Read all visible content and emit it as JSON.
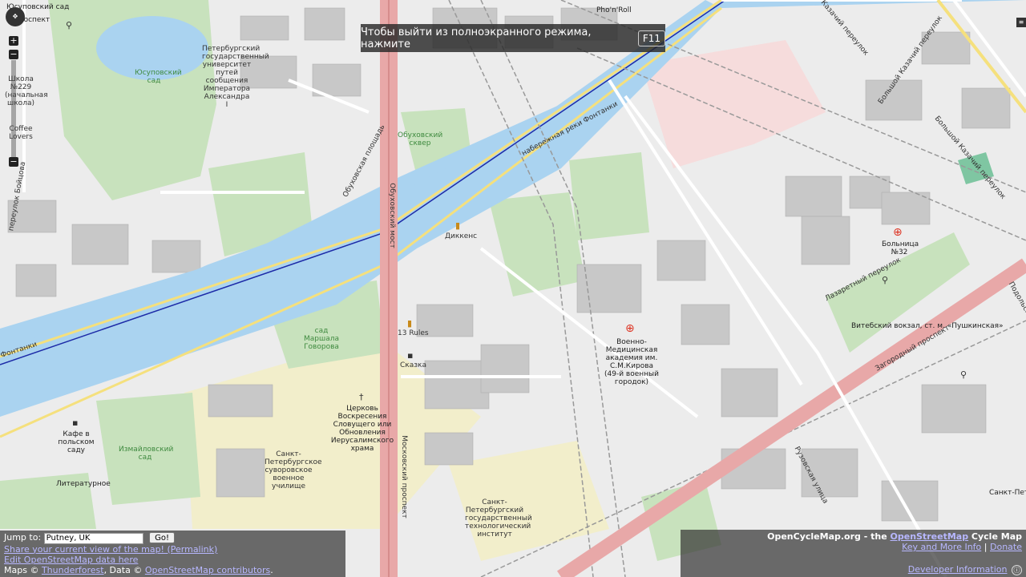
{
  "fullscreen_notice": {
    "text": "Чтобы выйти из полноэкранного режима, нажмите",
    "key": "F11"
  },
  "zoom": {
    "in": "+",
    "out": "−",
    "minus_mid": "−"
  },
  "labels": {
    "yusupov_garden_top": "Юсуповский сад",
    "prospekt_top": "проспект",
    "pho_n_roll": "Pho'n'Roll",
    "yusupov_garden": "Юсуповский сад",
    "university": "Петербургский государственный университет путей сообщения Императора Александра I",
    "school": "Школа №229 (начальная школа)",
    "coffee_lovers": "Coffee Lovers",
    "obukhovsky_sq": "Обуховский сквер",
    "obukhovskaya_ploshchad": "Обуховская площадь",
    "obukhovsky_most": "Обуховский мост",
    "naberezhnaya": "набережная реки Фонтанки",
    "fontanki_left": "Фонтанки",
    "dickens": "Диккенс",
    "thirteen_rules": "13 Rules",
    "skazka": "Сказка",
    "marshal_garden": "сад Маршала Говорова",
    "church": "Церковь Воскресения Словущего или Обновления Иерусалимского храма",
    "cafe": "Кафе в польском саду",
    "izmailovsky": "Измайловский сад",
    "literaturnoe": "Литературное",
    "suvorov": "Санкт-Петербургское суворовское военное училище",
    "moskovsky": "Московский проспект",
    "tech_inst": "Санкт-Петербургский государственный технологический институт",
    "military_med": "Военно-Медицинская академия им. С.М.Кирова (49-й военный городок)",
    "hospital": "Больница №32",
    "lazaretny": "Лазаретный переулок",
    "vitebsky": "Витебский вокзал, ст. м. «Пушкинская»",
    "zagorodny": "Загородный проспект",
    "ruzovskaya": "Рузовская улица",
    "bolshoy_kazachiy": "Большой Казачий переулок",
    "bolshoy_kazachiy2": "Большой Казачий переулок",
    "maly_kazachiy": "Казачий переулок",
    "bolshoy_b": "переулок Бойцова",
    "sankt_right": "Санкт-Петербург",
    "podol": "Подольская"
  },
  "footer_left": {
    "jump_label": "Jump to:",
    "jump_value": "Putney, UK",
    "go": "Go!",
    "share_link": "Share your current view of the map! (Permalink)",
    "edit_link": "Edit OpenStreetMap data here",
    "attr_prefix": "Maps ©",
    "thunderforest": "Thunderforest",
    "attr_mid": ", Data ©",
    "osm_contrib": "OpenStreetMap contributors",
    "attr_end": "."
  },
  "footer_right": {
    "title_prefix": "OpenCycleMap.org - the",
    "osm_link": "OpenStreetMap",
    "title_suffix": "Cycle Map",
    "key_link": "Key and More Info",
    "sep": "|",
    "donate_link": "Donate",
    "dev_link": "Developer Information"
  },
  "colors": {
    "water": "#aad3f0",
    "park": "#c8e2bd",
    "building": "#c8c8c8",
    "school_area": "#f2eecb",
    "hospital_area": "#f4d6d6",
    "main_road": "#e8a8a8",
    "cycle_route": "#1c2aa7"
  },
  "icons": {
    "church": "cross-icon",
    "hospital": "hospital-icon",
    "pub": "beer-icon",
    "cafe": "cup-icon",
    "toilets": "toilets-icon"
  }
}
